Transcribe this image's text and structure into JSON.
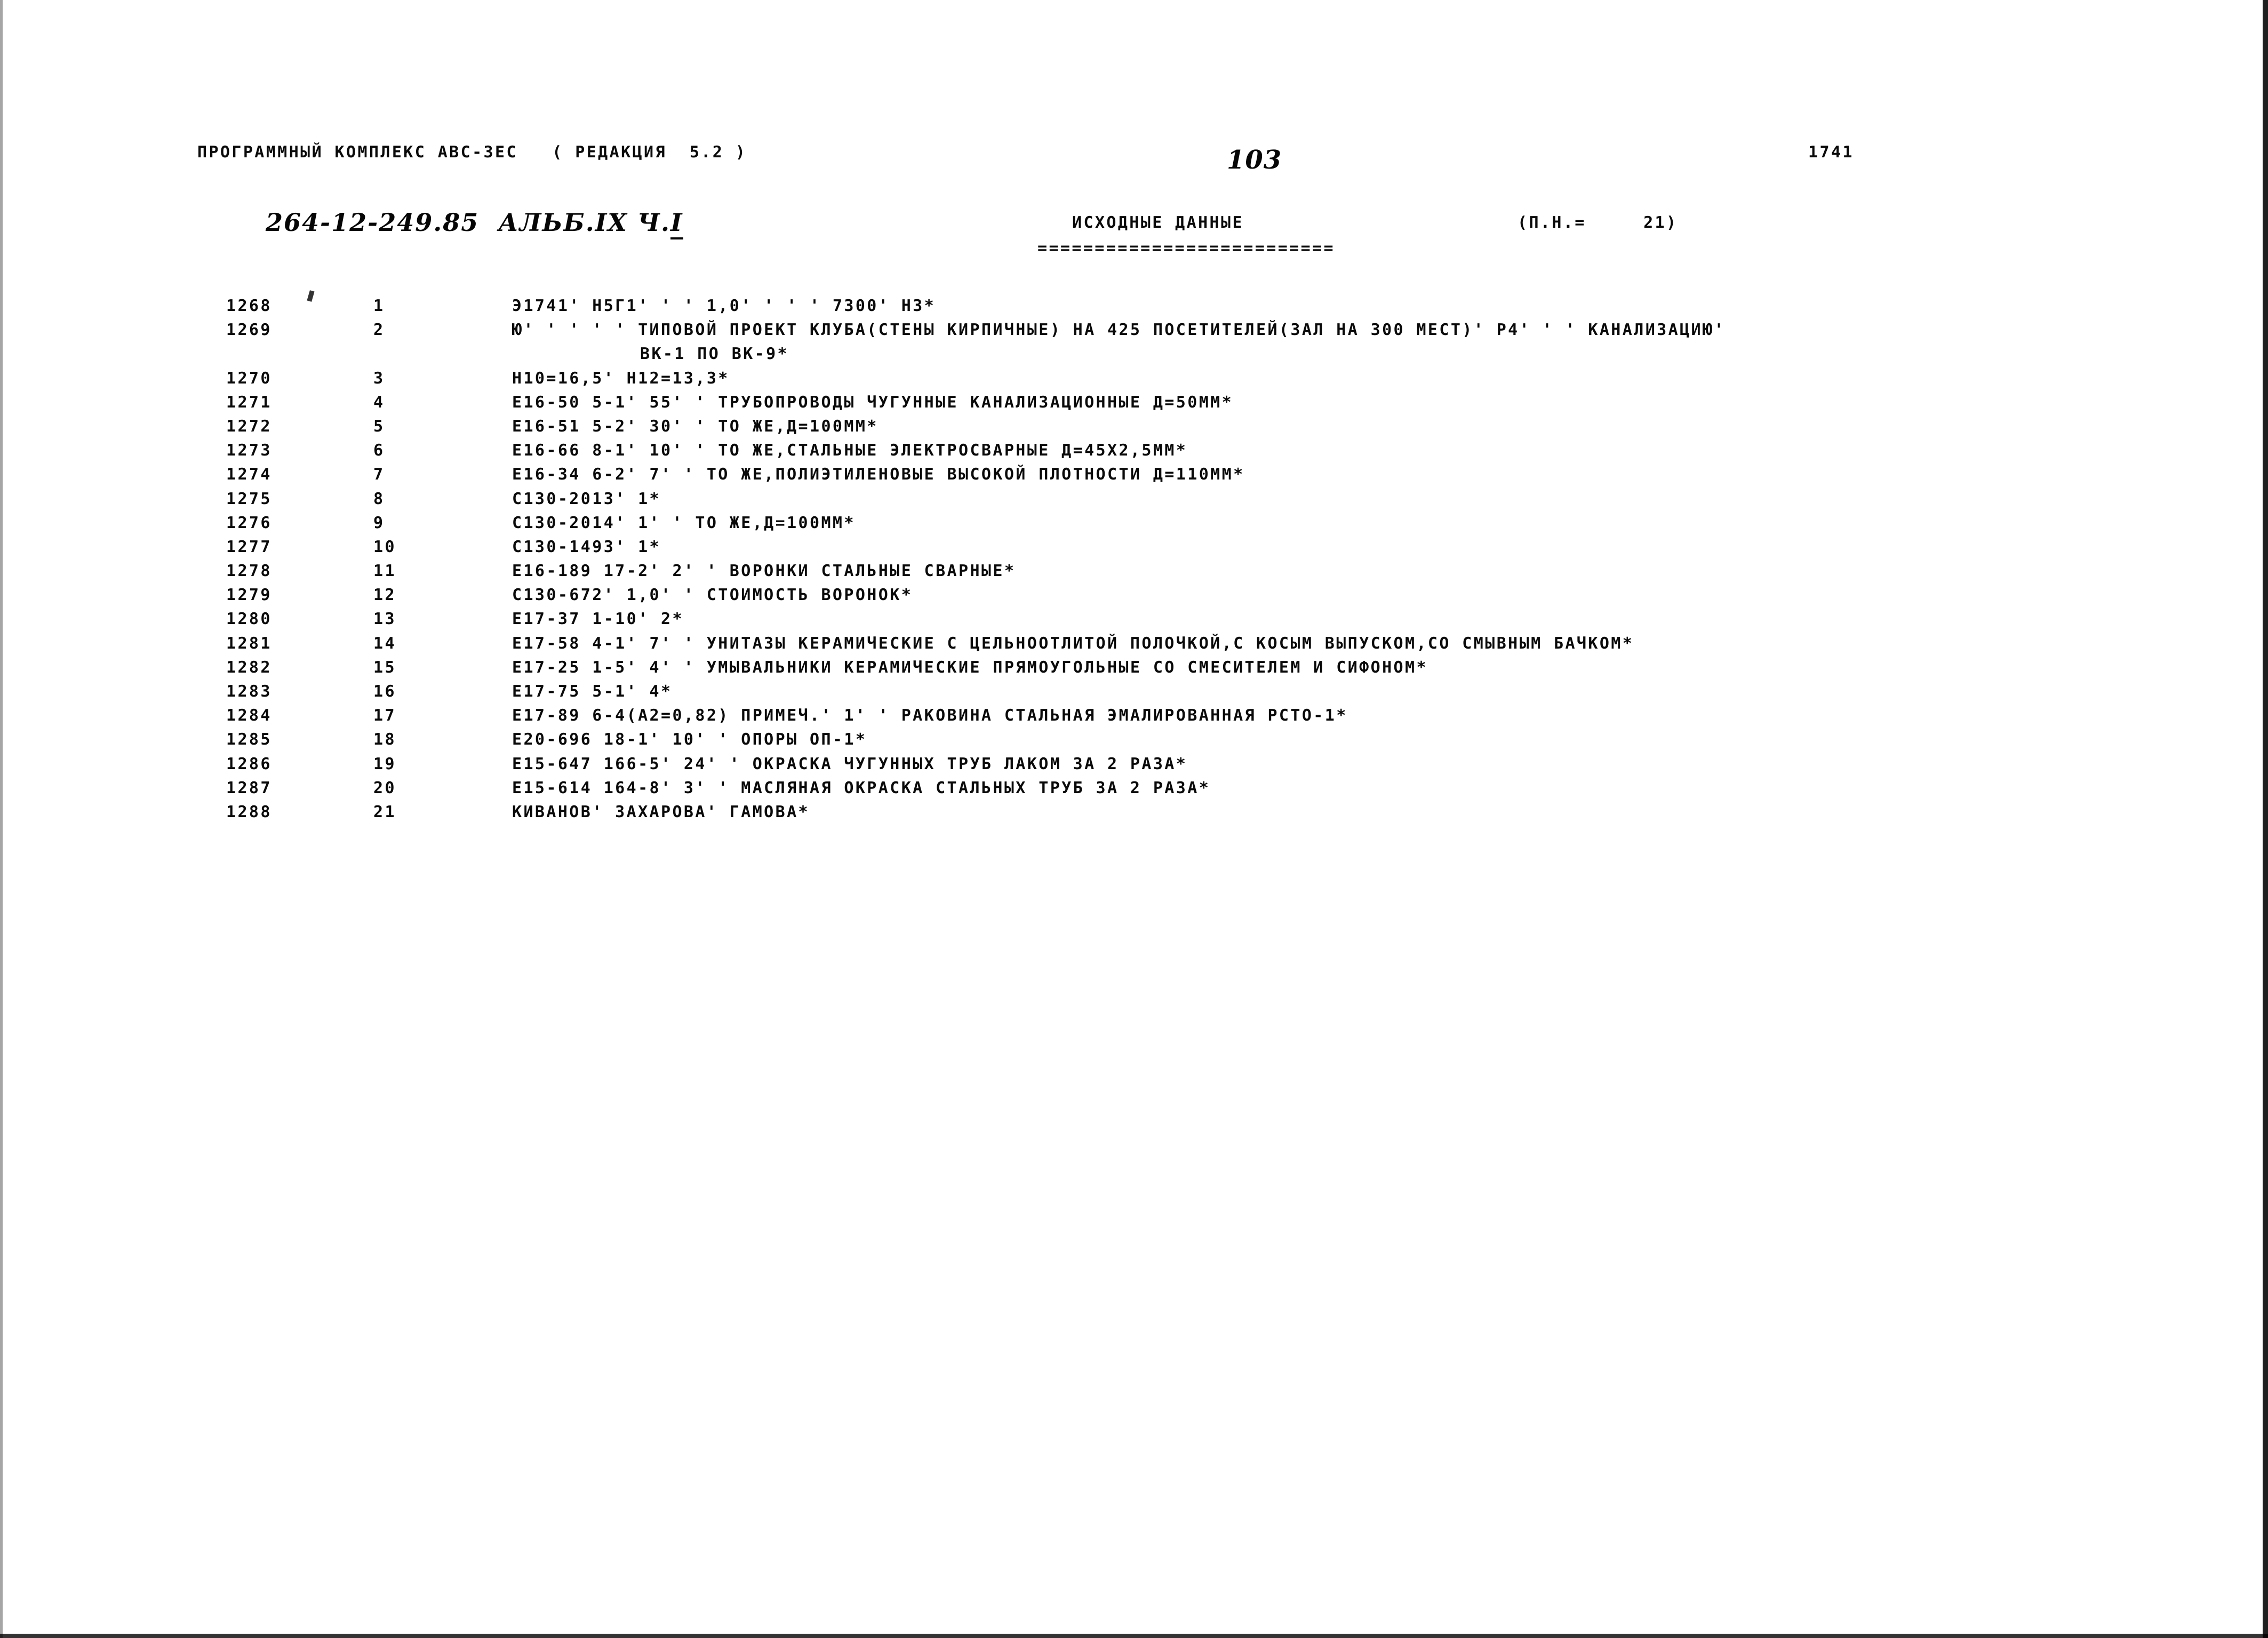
{
  "document": {
    "kind": "scanned-dot-matrix-printout",
    "page_background": "#ffffff",
    "ink_color": "#0a0a0a",
    "pen_color": "#060606"
  },
  "header": {
    "program_line": "ПРОГРАММНЫЙ КОМПЛЕКС АВС-ЗЕС   ( РЕДАКЦИЯ  5.2 )",
    "sheet_number": "103",
    "sequence_number": "1741",
    "handwritten_page_code_prefix": "264-12-249.85  АЛЬБ.IХ Ч.",
    "handwritten_page_code_suffix": "I"
  },
  "section": {
    "title": "ИСХОДНЫЕ ДАННЫЕ",
    "title_rule": "==========================",
    "counter": "(П.Н.=     21)"
  },
  "table": {
    "columns": [
      "line_no",
      "index",
      "text"
    ],
    "rows": [
      {
        "line_no": "1268",
        "index": "1",
        "text": "Э1741' Н5Г1' ' ' 1,0' ' ' ' 7300' Н3*",
        "continuation": false
      },
      {
        "line_no": "1269",
        "index": "2",
        "text": "Ю' ' ' ' ' ТИПОВОЙ ПРОЕКТ КЛУБА(СТЕНЫ КИРПИЧНЫЕ) НА 425 ПОСЕТИТЕЛЕЙ(ЗАЛ НА 300 МЕСТ)' Р4' ' ' КАНАЛИЗАЦИЮ'",
        "continuation": false
      },
      {
        "line_no": "",
        "index": "",
        "text": "ВК-1 ПО ВК-9*",
        "continuation": true
      },
      {
        "line_no": "1270",
        "index": "3",
        "text": "Н10=16,5' Н12=13,3*",
        "continuation": false
      },
      {
        "line_no": "1271",
        "index": "4",
        "text": "Е16-50 5-1' 55' ' ТРУБОПРОВОДЫ ЧУГУННЫЕ КАНАЛИЗАЦИОННЫЕ Д=50ММ*",
        "continuation": false
      },
      {
        "line_no": "1272",
        "index": "5",
        "text": "Е16-51 5-2' 30' ' ТО ЖЕ,Д=100ММ*",
        "continuation": false
      },
      {
        "line_no": "1273",
        "index": "6",
        "text": "Е16-66 8-1' 10' ' ТО ЖЕ,СТАЛЬНЫЕ ЭЛЕКТРОСВАРНЫЕ Д=45Х2,5ММ*",
        "continuation": false
      },
      {
        "line_no": "1274",
        "index": "7",
        "text": "Е16-34 6-2' 7' ' ТО ЖЕ,ПОЛИЭТИЛЕНОВЫЕ ВЫСОКОЙ ПЛОТНОСТИ Д=110ММ*",
        "continuation": false
      },
      {
        "line_no": "1275",
        "index": "8",
        "text": "С130-2013' 1*",
        "continuation": false
      },
      {
        "line_no": "1276",
        "index": "9",
        "text": "С130-2014' 1' ' ТО ЖЕ,Д=100ММ*",
        "continuation": false
      },
      {
        "line_no": "1277",
        "index": "10",
        "text": "С130-1493' 1*",
        "continuation": false
      },
      {
        "line_no": "1278",
        "index": "11",
        "text": "Е16-189 17-2' 2' ' ВОРОНКИ СТАЛЬНЫЕ СВАРНЫЕ*",
        "continuation": false
      },
      {
        "line_no": "1279",
        "index": "12",
        "text": "С130-672' 1,0' ' СТОИМОСТЬ ВОРОНОК*",
        "continuation": false
      },
      {
        "line_no": "1280",
        "index": "13",
        "text": "Е17-37 1-10' 2*",
        "continuation": false
      },
      {
        "line_no": "1281",
        "index": "14",
        "text": "Е17-58 4-1' 7' ' УНИТАЗЫ КЕРАМИЧЕСКИЕ С ЦЕЛЬНООТЛИТОЙ ПОЛОЧКОЙ,С КОСЫМ ВЫПУСКОМ,СО СМЫВНЫМ БАЧКОМ*",
        "continuation": false
      },
      {
        "line_no": "1282",
        "index": "15",
        "text": "Е17-25 1-5' 4' ' УМЫВАЛЬНИКИ КЕРАМИЧЕСКИЕ ПРЯМОУГОЛЬНЫЕ СО СМЕСИТЕЛЕМ И СИФОНОМ*",
        "continuation": false
      },
      {
        "line_no": "1283",
        "index": "16",
        "text": "Е17-75 5-1' 4*",
        "continuation": false
      },
      {
        "line_no": "1284",
        "index": "17",
        "text": "Е17-89 6-4(А2=0,82) ПРИМЕЧ.' 1' ' РАКОВИНА СТАЛЬНАЯ ЭМАЛИРОВАННАЯ РСТО-1*",
        "continuation": false
      },
      {
        "line_no": "1285",
        "index": "18",
        "text": "Е20-696 18-1' 10' ' ОПОРЫ ОП-1*",
        "continuation": false
      },
      {
        "line_no": "1286",
        "index": "19",
        "text": "Е15-647 166-5' 24' ' ОКРАСКА ЧУГУННЫХ ТРУБ ЛАКОМ ЗА 2 РАЗА*",
        "continuation": false
      },
      {
        "line_no": "1287",
        "index": "20",
        "text": "Е15-614 164-8' 3' ' МАСЛЯНАЯ ОКРАСКА СТАЛЬНЫХ ТРУБ ЗА 2 РАЗА*",
        "continuation": false
      },
      {
        "line_no": "1288",
        "index": "21",
        "text": "КИВАНОВ' ЗАХАРОВА' ГАМОВА*",
        "continuation": false
      }
    ]
  }
}
